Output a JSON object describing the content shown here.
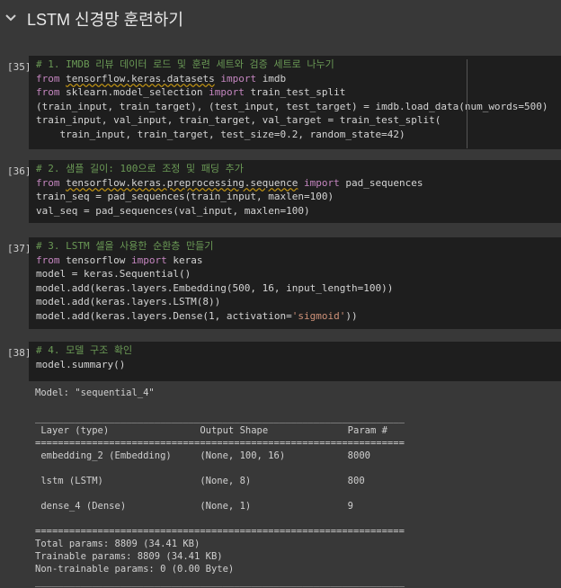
{
  "section": {
    "title": "LSTM 신경망 훈련하기"
  },
  "cells": [
    {
      "exec": "[35]",
      "lines": [
        [
          {
            "t": "# 1. IMDB 리뷰 데이터 로드 및 훈련 세트와 검증 세트로 나누기",
            "c": "cm"
          }
        ],
        [
          {
            "t": "from ",
            "c": "kw"
          },
          {
            "t": "tensorflow.keras.datasets",
            "c": "id ul"
          },
          {
            "t": " import ",
            "c": "kw"
          },
          {
            "t": "imdb",
            "c": "id"
          }
        ],
        [
          {
            "t": "from ",
            "c": "kw"
          },
          {
            "t": "sklearn.model_selection",
            "c": "id"
          },
          {
            "t": " import ",
            "c": "kw"
          },
          {
            "t": "train_test_split",
            "c": "id"
          }
        ],
        [
          {
            "t": "(train_input, train_target), (test_input, test_target) = imdb.load_data(num_words=500)",
            "c": "id"
          }
        ],
        [
          {
            "t": "train_input, val_input, train_target, val_target = train_test_split(",
            "c": "id"
          }
        ],
        [
          {
            "t": "    train_input, train_target, test_size=0.2, random_state=42)",
            "c": "id"
          }
        ]
      ]
    },
    {
      "exec": "[36]",
      "lines": [
        [
          {
            "t": "# 2. 샘플 길이: 100으로 조정 및 패딩 추가",
            "c": "cm"
          }
        ],
        [
          {
            "t": "from ",
            "c": "kw"
          },
          {
            "t": "tensorflow.keras.preprocessing.sequence",
            "c": "id ul"
          },
          {
            "t": " import ",
            "c": "kw"
          },
          {
            "t": "pad_sequences",
            "c": "id"
          }
        ],
        [
          {
            "t": "train_seq = pad_sequences(train_input, maxlen=100)",
            "c": "id"
          }
        ],
        [
          {
            "t": "val_seq = pad_sequences(val_input, maxlen=100)",
            "c": "id"
          }
        ]
      ]
    },
    {
      "exec": "[37]",
      "lines": [
        [
          {
            "t": "# 3. LSTM 셀을 사용한 순환층 만들기",
            "c": "cm"
          }
        ],
        [
          {
            "t": "from ",
            "c": "kw"
          },
          {
            "t": "tensorflow",
            "c": "id"
          },
          {
            "t": " import ",
            "c": "kw"
          },
          {
            "t": "keras",
            "c": "id"
          }
        ],
        [
          {
            "t": "model = keras.Sequential()",
            "c": "id"
          }
        ],
        [
          {
            "t": "model.add(keras.layers.Embedding(500, 16, input_length=100))",
            "c": "id"
          }
        ],
        [
          {
            "t": "model.add(keras.layers.LSTM(8))",
            "c": "id"
          }
        ],
        [
          {
            "t": "model.add(keras.layers.Dense(1, activation=",
            "c": "id"
          },
          {
            "t": "'sigmoid'",
            "c": "str"
          },
          {
            "t": "))",
            "c": "id"
          }
        ]
      ]
    },
    {
      "exec": "[38]",
      "lines": [
        [
          {
            "t": "# 4. 모델 구조 확인",
            "c": "cm"
          }
        ],
        [
          {
            "t": "model.summary()",
            "c": "id"
          }
        ]
      ]
    }
  ],
  "output": [
    "Model: \"sequential_4\"",
    "",
    "_________________________________________________________________",
    " Layer (type)                Output Shape              Param #   ",
    "=================================================================",
    " embedding_2 (Embedding)     (None, 100, 16)           8000      ",
    "",
    " lstm (LSTM)                 (None, 8)                 800       ",
    "",
    " dense_4 (Dense)             (None, 1)                 9         ",
    "",
    "=================================================================",
    "Total params: 8809 (34.41 KB)",
    "Trainable params: 8809 (34.41 KB)",
    "Non-trainable params: 0 (0.00 Byte)",
    "_________________________________________________________________"
  ],
  "icons": {
    "collapse": "chevron-down-icon"
  }
}
